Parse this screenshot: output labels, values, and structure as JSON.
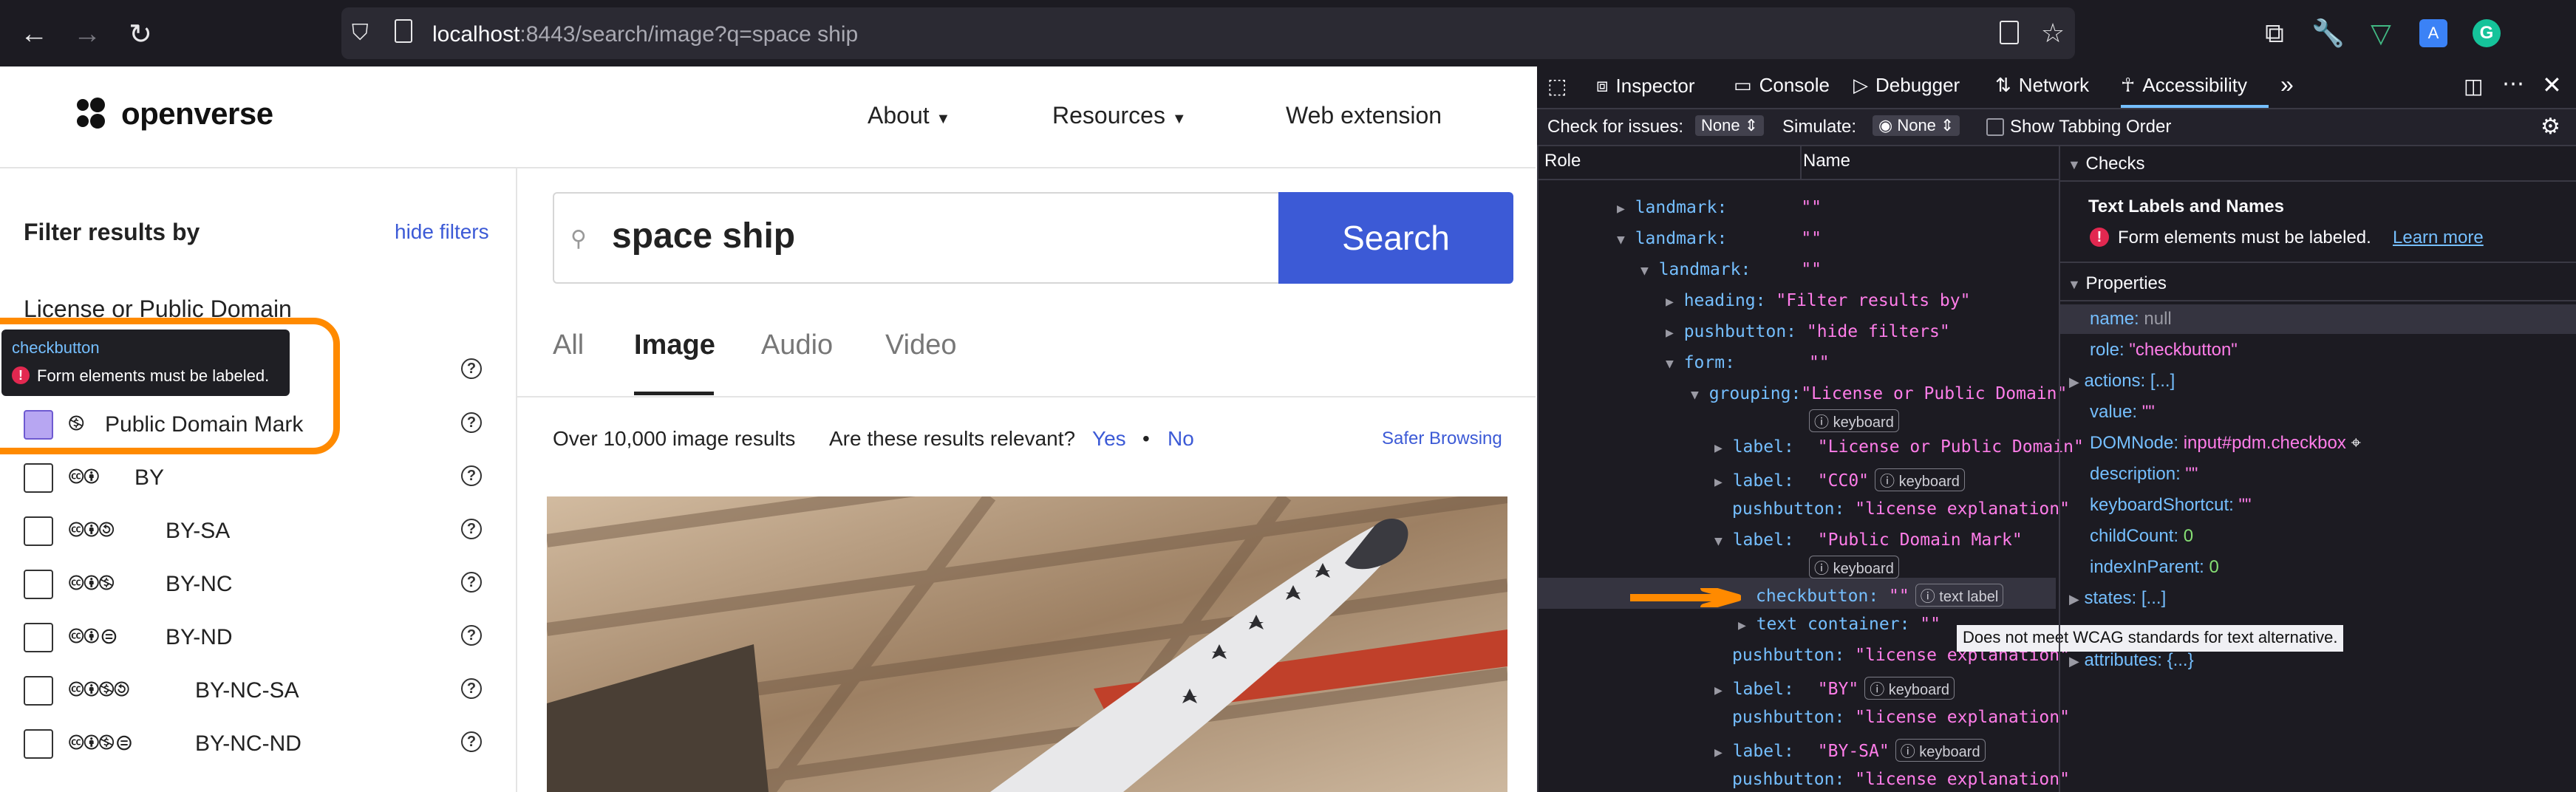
{
  "browser": {
    "url_host": "localhost",
    "url_rest": ":8443/search/image?q=space ship",
    "icons": [
      "back-icon",
      "forward-icon",
      "reload-icon",
      "shield-icon",
      "page-icon",
      "reader-icon",
      "star-icon",
      "extensions-icon",
      "tools-icon",
      "vue-icon",
      "translate-icon",
      "grammarly-icon"
    ],
    "grammarly_letter": "G"
  },
  "site": {
    "logo": "openverse",
    "nav": {
      "about": "About",
      "resources": "Resources",
      "web_extension": "Web extension"
    }
  },
  "sidebar": {
    "title": "Filter results by",
    "hide_filters": "hide filters",
    "section_title": "License or Public Domain",
    "licenses": [
      {
        "label": "CC0",
        "icons": "🅭"
      },
      {
        "label": "Public Domain Mark",
        "icons": "🄏",
        "checked": true
      },
      {
        "label": "BY",
        "icons": "🅭🅯"
      },
      {
        "label": "BY-SA",
        "icons": "🅭🅯🄎"
      },
      {
        "label": "BY-NC",
        "icons": "🅭🅯🄏"
      },
      {
        "label": "BY-ND",
        "icons": "🅭🅯⊜"
      },
      {
        "label": "BY-NC-SA",
        "icons": "🅭🅯🄏🄎"
      },
      {
        "label": "BY-NC-ND",
        "icons": "🅭🅯🄏⊜"
      }
    ],
    "help": "?"
  },
  "tooltip": {
    "role": "checkbutton",
    "message": "Form elements must be labeled.",
    "icon": "!"
  },
  "search": {
    "query": "space ship",
    "button": "Search"
  },
  "tabs": [
    "All",
    "Image",
    "Audio",
    "Video"
  ],
  "results": {
    "count": "Over 10,000 image results",
    "question": "Are these results relevant?",
    "yes": "Yes",
    "dot": "•",
    "no": "No",
    "safer": "Safer Browsing"
  },
  "devtools": {
    "tabs": [
      "Inspector",
      "Console",
      "Debugger",
      "Network",
      "Accessibility"
    ],
    "check_label": "Check for issues:",
    "check_value": "None",
    "simulate_label": "Simulate:",
    "simulate_value": "None",
    "tabbing": "Show Tabbing Order",
    "col_role": "Role",
    "col_name": "Name",
    "tree": [
      {
        "role": "landmark:",
        "name": "\"\""
      },
      {
        "role": "landmark:",
        "name": "\"\""
      },
      {
        "role": "landmark:",
        "name": "\"\""
      },
      {
        "role": "heading:",
        "name": "\"Filter results by\""
      },
      {
        "role": "pushbutton:",
        "name": "\"hide filters\""
      },
      {
        "role": "form:",
        "name": "\"\""
      },
      {
        "role": "grouping:",
        "name": "\"License or Public Domain\"",
        "badge": "keyboard"
      },
      {
        "role": "label:",
        "name": "\"License or Public Domain\""
      },
      {
        "role": "label:",
        "name": "\"CC0\"",
        "badge": "keyboard"
      },
      {
        "role": "pushbutton:",
        "name": "\"license explanation\""
      },
      {
        "role": "label:",
        "name": "\"Public Domain Mark\"",
        "badge": "keyboard"
      },
      {
        "role": "checkbutton:",
        "name": "\"\"",
        "badge": "text label"
      },
      {
        "role": "text container:",
        "name": "\"\""
      },
      {
        "role": "pushbutton:",
        "name": "\"license explanation\""
      },
      {
        "role": "label:",
        "name": "\"BY\"",
        "badge": "keyboard"
      },
      {
        "role": "pushbutton:",
        "name": "\"license explanation\""
      },
      {
        "role": "label:",
        "name": "\"BY-SA\"",
        "badge": "keyboard"
      },
      {
        "role": "pushbutton:",
        "name": "\"license explanation\""
      }
    ],
    "wcag_tooltip": "Does not meet WCAG standards for text alternative.",
    "checks_title": "Checks",
    "checks_heading": "Text Labels and Names",
    "checks_message": "Form elements must be labeled.",
    "learn_more": "Learn more",
    "properties_title": "Properties",
    "props": [
      {
        "key": "name:",
        "val": "null"
      },
      {
        "key": "role:",
        "val": "\"checkbutton\""
      },
      {
        "key": "actions:",
        "val": "[...]"
      },
      {
        "key": "value:",
        "val": "\"\""
      },
      {
        "key": "DOMNode:",
        "val": "input#pdm.checkbox"
      },
      {
        "key": "description:",
        "val": "\"\""
      },
      {
        "key": "keyboardShortcut:",
        "val": "\"\""
      },
      {
        "key": "childCount:",
        "val": "0"
      },
      {
        "key": "indexInParent:",
        "val": "0"
      },
      {
        "key": "states:",
        "val": "[...]"
      },
      {
        "key": "attributes:",
        "val": "{...}"
      }
    ]
  },
  "colors": {
    "accent": "#3c5ad6",
    "annotation": "#ff8a00",
    "devtools_bg": "#1c1b22"
  }
}
